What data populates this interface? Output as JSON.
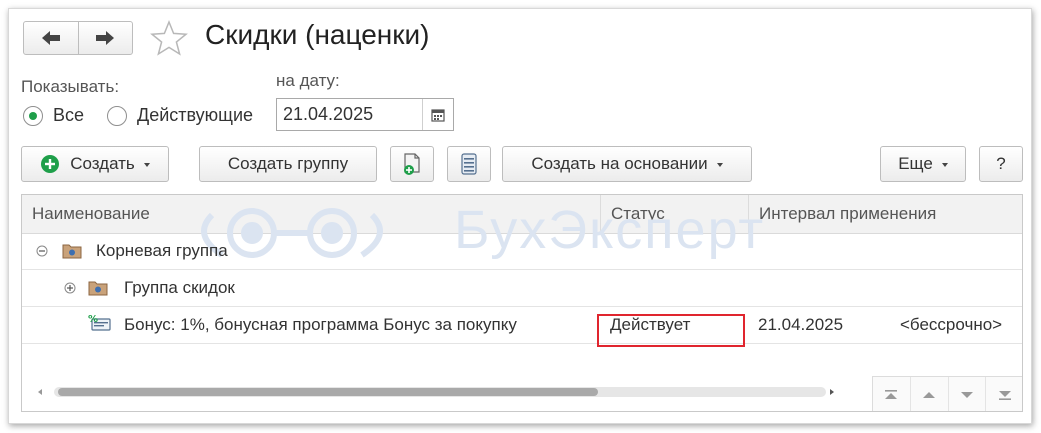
{
  "window": {
    "title": "Скидки (наценки)",
    "watermark_text": "БухЭксперт"
  },
  "filter": {
    "show_label": "Показывать:",
    "options": [
      {
        "label": "Все",
        "selected": true
      },
      {
        "label": "Действующие",
        "selected": false
      }
    ],
    "date_label": "на дату:",
    "date_value": "21.04.2025"
  },
  "toolbar": {
    "create_label": "Создать",
    "create_group_label": "Создать группу",
    "create_based_on_label": "Создать на основании",
    "more_label": "Еще",
    "help_label": "?"
  },
  "table": {
    "columns": [
      "Наименование",
      "Статус",
      "Интервал применения"
    ],
    "rows": [
      {
        "name": "Корневая группа"
      },
      {
        "name": "Группа скидок"
      },
      {
        "name": "Бонус: 1%, бонусная программа Бонус за покупку",
        "status": "Действует",
        "interval_from": "21.04.2025",
        "interval_to": "<бессрочно>"
      }
    ]
  },
  "colors": {
    "accent_green": "#1f9f4a",
    "highlight_red": "#e0252e",
    "watermark": "#dbe4f1"
  }
}
